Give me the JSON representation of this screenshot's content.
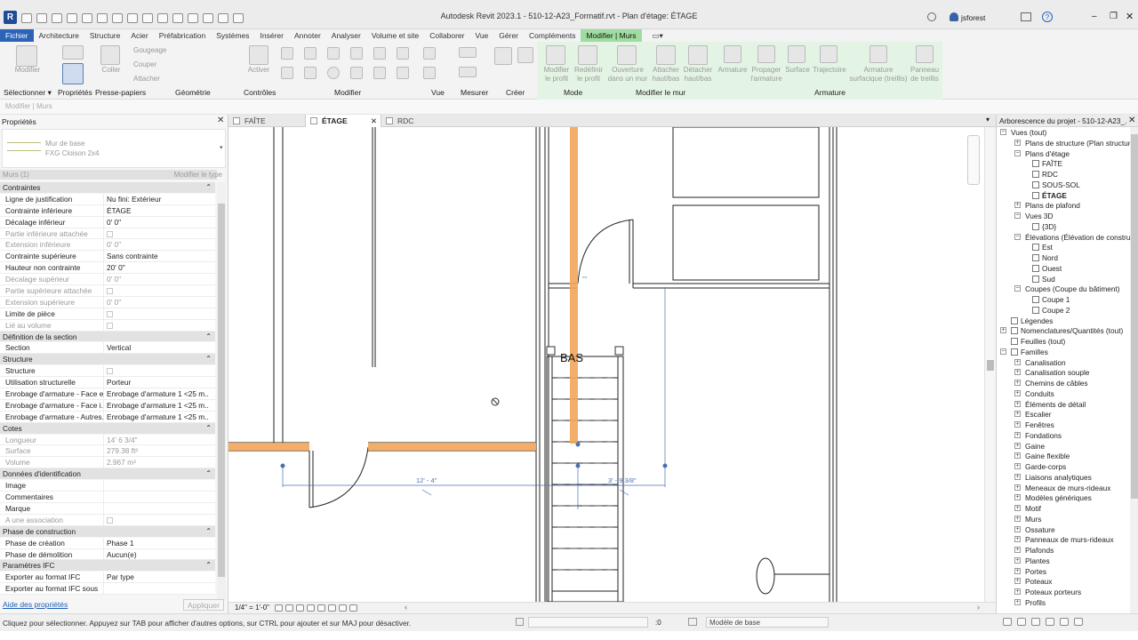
{
  "window": {
    "title": "Autodesk Revit 2023.1 - 510-12-A23_Formatif.rvt - Plan d'étage: ÉTAGE",
    "user": "jsforest",
    "logo": "R"
  },
  "menu": [
    "Fichier",
    "Architecture",
    "Structure",
    "Acier",
    "Préfabrication",
    "Systèmes",
    "Insérer",
    "Annoter",
    "Analyser",
    "Volume et site",
    "Collaborer",
    "Vue",
    "Gérer",
    "Compléments",
    "Modifier | Murs"
  ],
  "ribbon": {
    "buttons": {
      "modifier": "Modifier",
      "coller": "Coller",
      "gougeage": "Gougeage",
      "couper": "Couper",
      "attacher": "Attacher",
      "activer": "Activer",
      "modifier_profil": "Modifier\nle profil",
      "redefinir_profil": "Redéfinir\nle profil",
      "ouverture": "Ouverture\ndans un mur",
      "attacher_haut": "Attacher\nhaut/bas",
      "detacher_haut": "Détacher\nhaut/bas",
      "armature": "Armature",
      "propager": "Propager\nl'armature",
      "surface": "Surface",
      "trajectoire": "Trajectoire",
      "armature_surf": "Armature\nsurfacique (treillis)",
      "panneau": "Panneau\nde treillis"
    },
    "groups": {
      "selectionner": "Sélectionner",
      "proprietes": "Propriétés",
      "presse": "Presse-papiers",
      "geometrie": "Géométrie",
      "controles": "Contrôles",
      "modifier": "Modifier",
      "vue": "Vue",
      "mesurer": "Mesurer",
      "creer": "Créer",
      "mode": "Mode",
      "modifier_mur": "Modifier le mur",
      "armature": "Armature"
    }
  },
  "context_bar": "Modifier | Murs",
  "properties": {
    "title": "Propriétés",
    "type_family": "Mur de base",
    "type_name": "FXG Cloison 2x4",
    "instance": "Murs (1)",
    "edit_type": "Modifier le type",
    "help_link": "Aide des propriétés",
    "apply": "Appliquer",
    "sections": [
      {
        "name": "Contraintes",
        "rows": [
          {
            "n": "Ligne de justification",
            "v": "Nu fini: Extérieur"
          },
          {
            "n": "Contrainte inférieure",
            "v": "ÉTAGE"
          },
          {
            "n": "Décalage inférieur",
            "v": "0'  0\""
          },
          {
            "n": "Partie inférieure attachée",
            "v": "",
            "cb": true,
            "dis": true
          },
          {
            "n": "Extension inférieure",
            "v": "0'  0\"",
            "dis": true
          },
          {
            "n": "Contrainte supérieure",
            "v": "Sans contrainte"
          },
          {
            "n": "Hauteur non contrainte",
            "v": "20'  0\""
          },
          {
            "n": "Décalage supérieur",
            "v": "0'  0\"",
            "dis": true
          },
          {
            "n": "Partie supérieure attachée",
            "v": "",
            "cb": true,
            "dis": true
          },
          {
            "n": "Extension supérieure",
            "v": "0'  0\"",
            "dis": true
          },
          {
            "n": "Limite de pièce",
            "v": "",
            "cb": true
          },
          {
            "n": "Lié au volume",
            "v": "",
            "cb": true,
            "dis": true
          }
        ]
      },
      {
        "name": "Définition de la section",
        "rows": [
          {
            "n": "Section",
            "v": "Vertical"
          }
        ]
      },
      {
        "name": "Structure",
        "rows": [
          {
            "n": "Structure",
            "v": "",
            "cb": true
          },
          {
            "n": "Utilisation structurelle",
            "v": "Porteur"
          },
          {
            "n": "Enrobage d'armature - Face e...",
            "v": "Enrobage d'armature 1 <25 m..."
          },
          {
            "n": "Enrobage d'armature - Face i...",
            "v": "Enrobage d'armature 1 <25 m..."
          },
          {
            "n": "Enrobage d'armature - Autres...",
            "v": "Enrobage d'armature 1 <25 m..."
          }
        ]
      },
      {
        "name": "Cotes",
        "rows": [
          {
            "n": "Longueur",
            "v": "14'  6 3/4\"",
            "dis": true
          },
          {
            "n": "Surface",
            "v": "279.38 ft²",
            "dis": true
          },
          {
            "n": "Volume",
            "v": "2.967 m³",
            "dis": true
          }
        ]
      },
      {
        "name": "Données d'identification",
        "rows": [
          {
            "n": "Image",
            "v": ""
          },
          {
            "n": "Commentaires",
            "v": ""
          },
          {
            "n": "Marque",
            "v": ""
          },
          {
            "n": "A une association",
            "v": "",
            "cb": true,
            "dis": true
          }
        ]
      },
      {
        "name": "Phase de construction",
        "rows": [
          {
            "n": "Phase de création",
            "v": "Phase 1"
          },
          {
            "n": "Phase de démolition",
            "v": "Aucun(e)"
          }
        ]
      },
      {
        "name": "Paramètres IFC",
        "rows": [
          {
            "n": "Exporter au format IFC",
            "v": "Par type"
          },
          {
            "n": "Exporter au format IFC sous",
            "v": ""
          }
        ]
      }
    ]
  },
  "view_tabs": [
    "FAÎTE",
    "ÉTAGE",
    "RDC"
  ],
  "canvas": {
    "room_label": "BAS",
    "dim1": "12' - 4\"",
    "dim2": "3' - 9 3/8\""
  },
  "view_control": {
    "scale": "1/4\" = 1'-0\""
  },
  "browser": {
    "title": "Arborescence du projet - 510-12-A23_...",
    "items": [
      {
        "t": "Vues (tout)",
        "l": 0,
        "tog": "−"
      },
      {
        "t": "Plans de structure (Plan structure...",
        "l": 1,
        "tog": "+"
      },
      {
        "t": "Plans d'étage",
        "l": 1,
        "tog": "−"
      },
      {
        "t": "FAÎTE",
        "l": 2,
        "v": true
      },
      {
        "t": "RDC",
        "l": 2,
        "v": true
      },
      {
        "t": "SOUS-SOL",
        "l": 2,
        "v": true
      },
      {
        "t": "ÉTAGE",
        "l": 2,
        "v": true,
        "b": true
      },
      {
        "t": "Plans de plafond",
        "l": 1,
        "tog": "+"
      },
      {
        "t": "Vues 3D",
        "l": 1,
        "tog": "−"
      },
      {
        "t": "{3D}",
        "l": 2,
        "v": true
      },
      {
        "t": "Élévations (Élévation de construc...",
        "l": 1,
        "tog": "−"
      },
      {
        "t": "Est",
        "l": 2,
        "v": true
      },
      {
        "t": "Nord",
        "l": 2,
        "v": true
      },
      {
        "t": "Ouest",
        "l": 2,
        "v": true
      },
      {
        "t": "Sud",
        "l": 2,
        "v": true
      },
      {
        "t": "Coupes (Coupe du bâtiment)",
        "l": 1,
        "tog": "−"
      },
      {
        "t": "Coupe 1",
        "l": 2,
        "v": true
      },
      {
        "t": "Coupe 2",
        "l": 2,
        "v": true
      },
      {
        "t": "Légendes",
        "l": 0,
        "i": true
      },
      {
        "t": "Nomenclatures/Quantités (tout)",
        "l": 0,
        "tog": "+",
        "i": true
      },
      {
        "t": "Feuilles (tout)",
        "l": 0,
        "i": true
      },
      {
        "t": "Familles",
        "l": 0,
        "tog": "−",
        "i": true
      },
      {
        "t": "Canalisation",
        "l": 1,
        "tog": "+"
      },
      {
        "t": "Canalisation souple",
        "l": 1,
        "tog": "+"
      },
      {
        "t": "Chemins de câbles",
        "l": 1,
        "tog": "+"
      },
      {
        "t": "Conduits",
        "l": 1,
        "tog": "+"
      },
      {
        "t": "Éléments de détail",
        "l": 1,
        "tog": "+"
      },
      {
        "t": "Escalier",
        "l": 1,
        "tog": "+"
      },
      {
        "t": "Fenêtres",
        "l": 1,
        "tog": "+"
      },
      {
        "t": "Fondations",
        "l": 1,
        "tog": "+"
      },
      {
        "t": "Gaine",
        "l": 1,
        "tog": "+"
      },
      {
        "t": "Gaine flexible",
        "l": 1,
        "tog": "+"
      },
      {
        "t": "Garde-corps",
        "l": 1,
        "tog": "+"
      },
      {
        "t": "Liaisons analytiques",
        "l": 1,
        "tog": "+"
      },
      {
        "t": "Meneaux de murs-rideaux",
        "l": 1,
        "tog": "+"
      },
      {
        "t": "Modèles génériques",
        "l": 1,
        "tog": "+"
      },
      {
        "t": "Motif",
        "l": 1,
        "tog": "+"
      },
      {
        "t": "Murs",
        "l": 1,
        "tog": "+"
      },
      {
        "t": "Ossature",
        "l": 1,
        "tog": "+"
      },
      {
        "t": "Panneaux de murs-rideaux",
        "l": 1,
        "tog": "+"
      },
      {
        "t": "Plafonds",
        "l": 1,
        "tog": "+"
      },
      {
        "t": "Plantes",
        "l": 1,
        "tog": "+"
      },
      {
        "t": "Portes",
        "l": 1,
        "tog": "+"
      },
      {
        "t": "Poteaux",
        "l": 1,
        "tog": "+"
      },
      {
        "t": "Poteaux porteurs",
        "l": 1,
        "tog": "+"
      },
      {
        "t": "Profils",
        "l": 1,
        "tog": "+"
      }
    ]
  },
  "status": {
    "text": "Cliquez pour sélectionner. Appuyez sur TAB pour afficher d'autres options, sur CTRL pour ajouter et sur MAJ pour désactiver.",
    "count": ":0",
    "model": "Modèle de base"
  },
  "colors": {
    "accent": "#2b63b6",
    "context_tab": "#9fdc9f",
    "wall_highlight": "#f2a65a"
  }
}
